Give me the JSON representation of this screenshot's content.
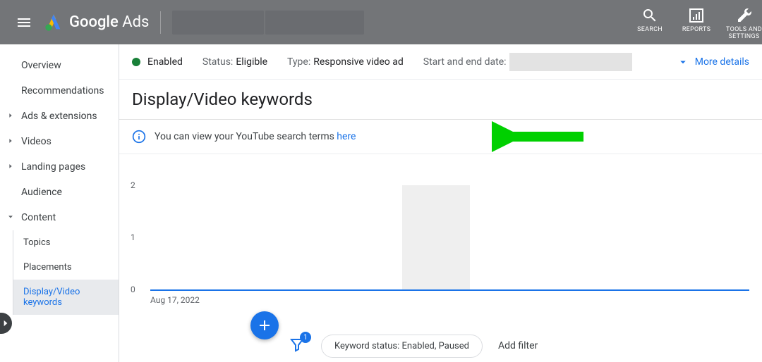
{
  "header": {
    "brand_bold": "Google",
    "brand_light": "Ads",
    "tools": {
      "search": "SEARCH",
      "reports": "REPORTS",
      "tools": "TOOLS AND\nSETTINGS"
    }
  },
  "sidebar": {
    "items": [
      {
        "label": "Overview"
      },
      {
        "label": "Recommendations"
      },
      {
        "label": "Ads & extensions"
      },
      {
        "label": "Videos"
      },
      {
        "label": "Landing pages"
      },
      {
        "label": "Audience"
      },
      {
        "label": "Content"
      }
    ],
    "content_sub": [
      {
        "label": "Topics"
      },
      {
        "label": "Placements"
      },
      {
        "label": "Display/Video keywords"
      }
    ]
  },
  "statusbar": {
    "enabled": "Enabled",
    "status_label": "Status:",
    "status_value": "Eligible",
    "type_label": "Type:",
    "type_value": "Responsive video ad",
    "date_label": "Start and end date:",
    "more": "More details"
  },
  "page_title": "Display/Video keywords",
  "notice": {
    "text": "You can view your YouTube search terms ",
    "link": "here"
  },
  "toolbar": {
    "filter_badge": "1",
    "chip": "Keyword status: Enabled, Paused",
    "add_filter": "Add filter"
  },
  "chart_data": {
    "type": "line",
    "yticks": [
      0,
      1,
      2
    ],
    "ylim": [
      0,
      2
    ],
    "x_start_label": "Aug 17, 2022",
    "series": [
      {
        "name": "series1",
        "values": [
          0
        ]
      }
    ]
  }
}
